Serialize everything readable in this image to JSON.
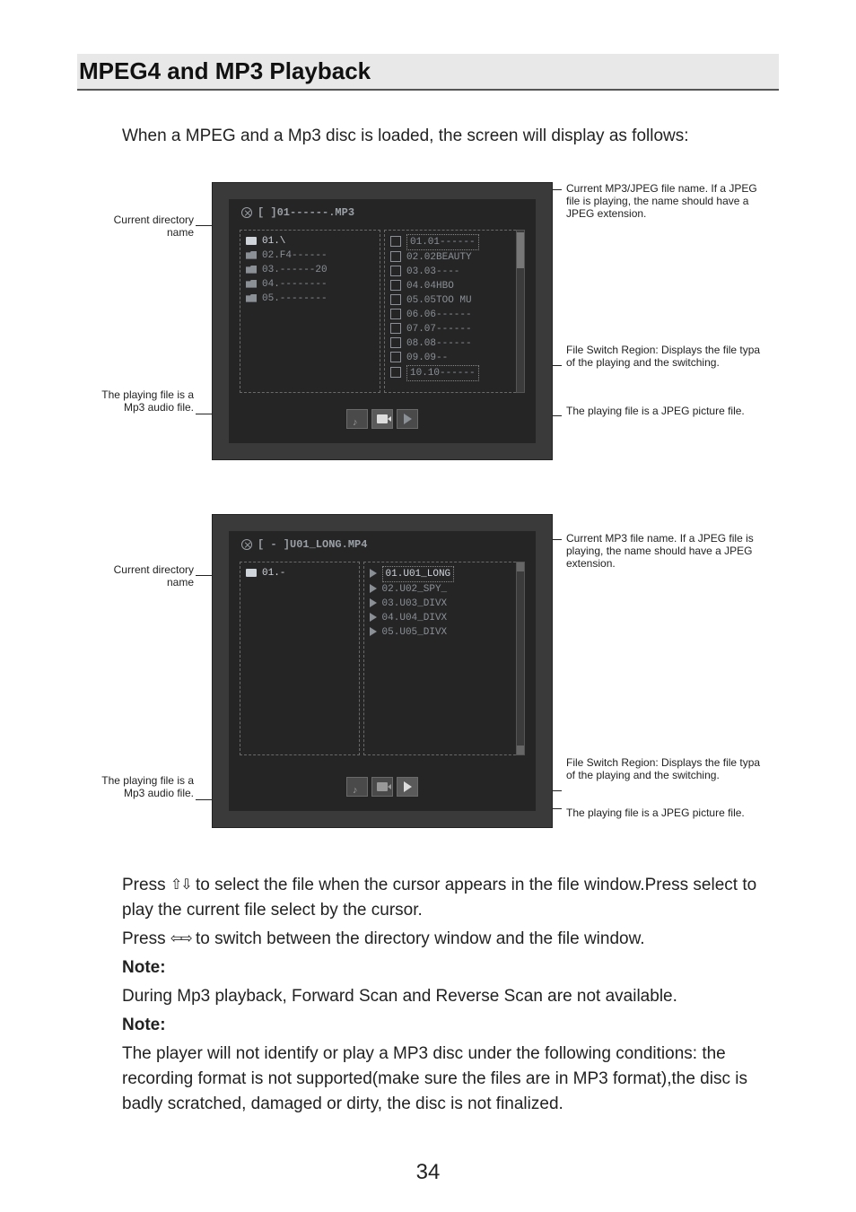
{
  "title": "MPEG4 and MP3 Playback",
  "intro": "When a MPEG and a Mp3 disc is loaded, the screen will display as follows:",
  "fig1": {
    "header": "[ ]01------.MP3",
    "dir_label": "Current directory name",
    "playing_left_label": "The playing file is a Mp3 audio file.",
    "file_label": "Current MP3/JPEG file name. If a JPEG file is playing, the name should have a JPEG extension.",
    "switch_label": "File Switch Region: Displays the file typa of the playing and the switching.",
    "jpeg_label": "The playing file is a JPEG picture file.",
    "dirs": [
      {
        "txt": "01.\\",
        "sel": true
      },
      {
        "txt": "02.F4------"
      },
      {
        "txt": "03.------20"
      },
      {
        "txt": "04.--------"
      },
      {
        "txt": "05.--------"
      }
    ],
    "files": [
      {
        "txt": "01.01------",
        "box": true
      },
      {
        "txt": "02.02BEAUTY"
      },
      {
        "txt": "03.03----"
      },
      {
        "txt": "04.04HBO"
      },
      {
        "txt": "05.05TOO MU"
      },
      {
        "txt": "06.06------"
      },
      {
        "txt": "07.07------"
      },
      {
        "txt": "08.08------"
      },
      {
        "txt": "09.09--"
      },
      {
        "txt": "10.10------",
        "box": true
      }
    ]
  },
  "fig2": {
    "header": "[ - ]U01_LONG.MP4",
    "dir_label": "Current directory name",
    "playing_left_label": "The playing file is a Mp3 audio file.",
    "file_label": "Current MP3 file name. If a JPEG file is playing, the name should have a JPEG extension.",
    "switch_label": "File Switch Region: Displays the file typa of the playing and the switching.",
    "jpeg_label": "The playing file is a JPEG picture file.",
    "dirs": [
      {
        "txt": "01.-",
        "sel": true
      }
    ],
    "files": [
      {
        "txt": "01.U01_LONG",
        "box": true,
        "hl": true
      },
      {
        "txt": "02.U02_SPY_"
      },
      {
        "txt": "03.U03_DIVX"
      },
      {
        "txt": "04.U04_DIVX"
      },
      {
        "txt": "05.U05_DIVX"
      }
    ]
  },
  "body": {
    "p1a": "Press ",
    "p1b": " to select the file when the cursor appears in the file window.Press select to play the current file select by the cursor.",
    "p2a": "Press ",
    "p2b": " to switch between the directory window and the file window.",
    "note1_h": "Note:",
    "note1": "During Mp3 playback, Forward Scan and Reverse Scan are not available.",
    "note2_h": "Note:",
    "note2": "The player will not identify or play a MP3 disc under the following conditions: the recording format is not supported(make sure the files are in MP3 format),the disc is badly scratched, damaged or dirty, the disc is not finalized."
  },
  "page_number": "34"
}
